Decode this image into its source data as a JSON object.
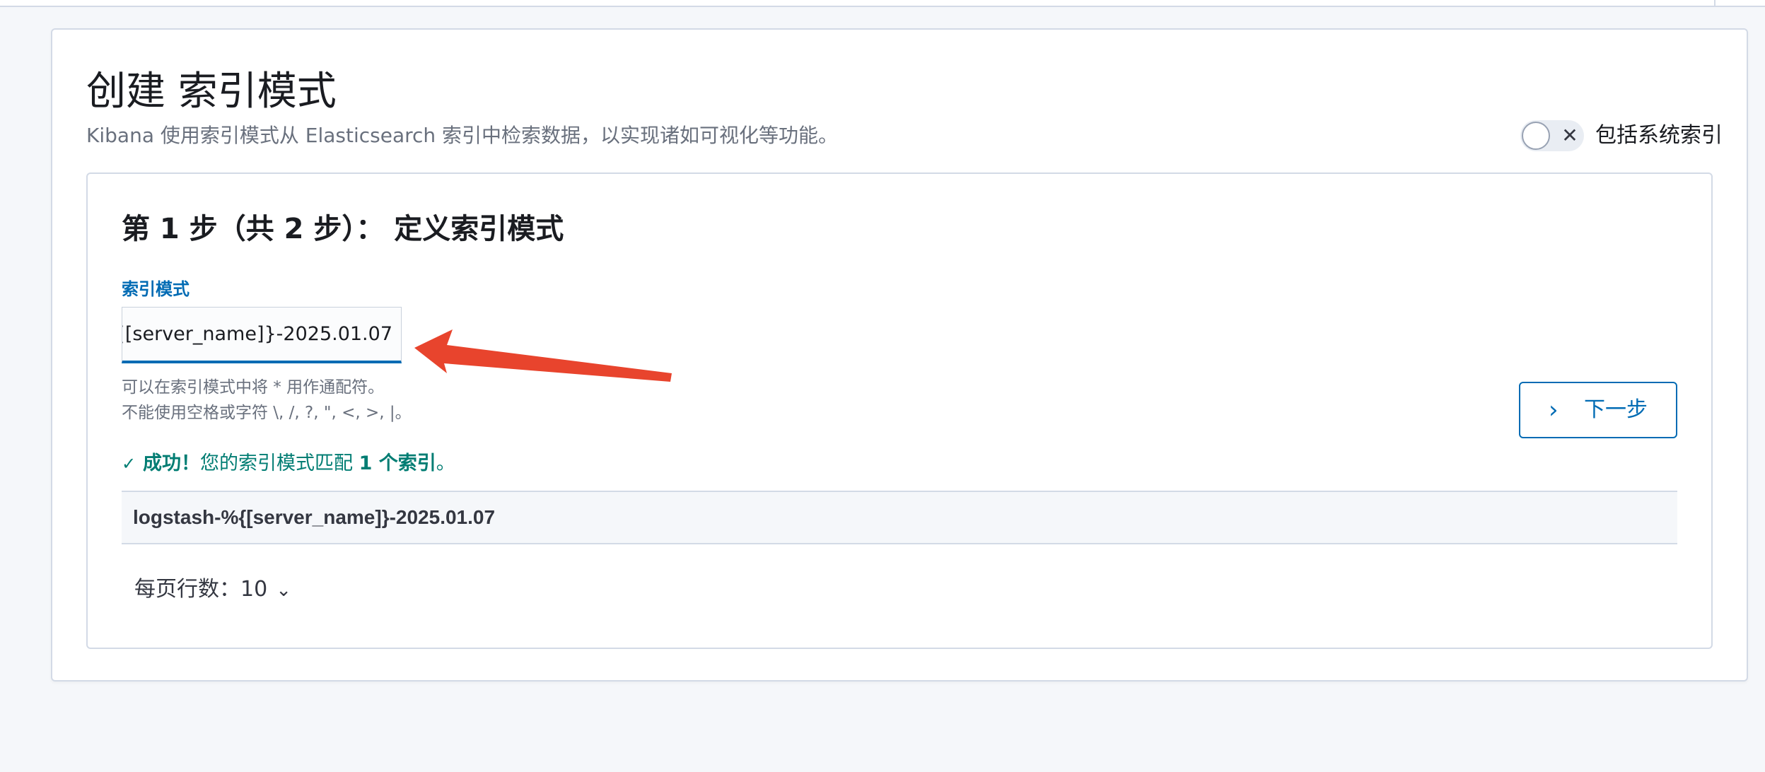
{
  "page": {
    "title": "创建 索引模式",
    "description": "Kibana 使用索引模式从 Elasticsearch 索引中检索数据，以实现诸如可视化等功能。",
    "include_system_indices_label": "包括系统索引",
    "include_system_indices_on": false
  },
  "step": {
    "title": "第 1 步（共 2 步）： 定义索引模式",
    "field_label": "索引模式",
    "input_value": "logstash-%{[server_name]}-2025.01.07",
    "help_line_1": "可以在索引模式中将 * 用作通配符。",
    "help_line_2": "不能使用空格或字符 \\, /, ?, \", <, >, |。",
    "success_prefix": "成功！",
    "success_middle": "您的索引模式匹配",
    "success_count": "1 个索引",
    "success_suffix": "。",
    "next_button": "下一步"
  },
  "matches": {
    "rows": [
      "logstash-%{[server_name]}-2025.01.07"
    ]
  },
  "pagination": {
    "label": "每页行数：",
    "value": "10"
  },
  "colors": {
    "primary": "#006bb4",
    "success": "#017d73",
    "annotation_arrow": "#e8442d"
  },
  "icons": {
    "toggle": "cross-icon",
    "next": "chevron-right-icon",
    "success": "check-icon",
    "rows": "chevron-down-icon"
  }
}
